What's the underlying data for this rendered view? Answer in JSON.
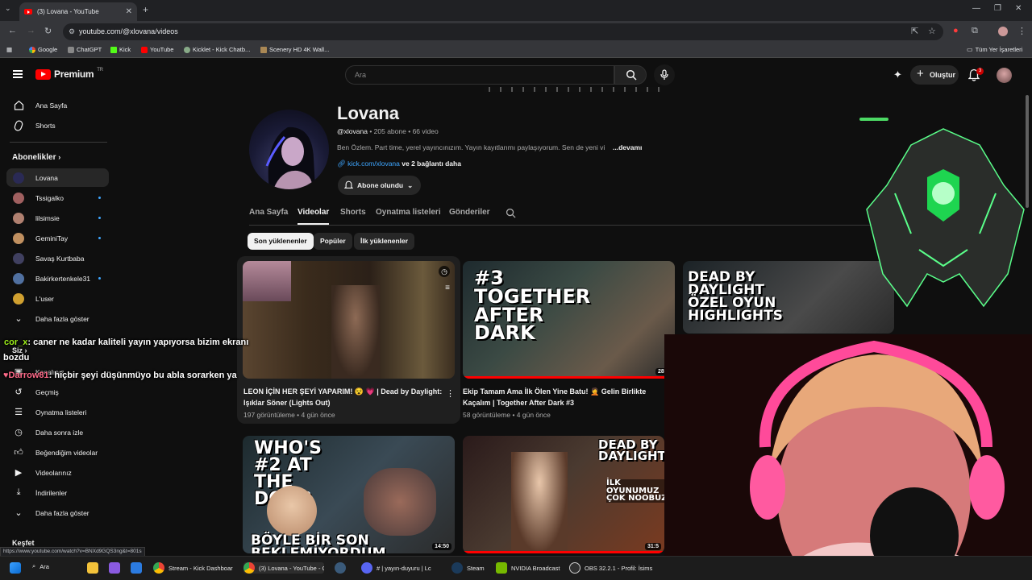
{
  "browser": {
    "tab_title": "(3) Lovana - YouTube",
    "url": "youtube.com/@xlovana/videos",
    "bookmarks": [
      "Google",
      "ChatGPT",
      "Kick",
      "YouTube",
      "Kicklet - Kick Chatb...",
      "Scenery HD 4K Wall..."
    ],
    "all_bookmarks": "Tüm Yer İşaretleri"
  },
  "masthead": {
    "logo_text": "Premium",
    "logo_region": "TR",
    "search_placeholder": "Ara",
    "create_label": "Oluştur",
    "notification_count": "3"
  },
  "sidebar": {
    "home": "Ana Sayfa",
    "shorts": "Shorts",
    "subscriptions_heading": "Abonelikler",
    "subscriptions": [
      {
        "name": "Lovana",
        "live": false,
        "color": "#2a2a55"
      },
      {
        "name": "Tssigalko",
        "live": true,
        "color": "#a06060"
      },
      {
        "name": "lilsimsie",
        "live": true,
        "color": "#b08070"
      },
      {
        "name": "GeminiTay",
        "live": true,
        "color": "#c09060"
      },
      {
        "name": "Savaş Kurtbaba",
        "live": false,
        "color": "#404060"
      },
      {
        "name": "Bakirkertenkele31",
        "live": true,
        "color": "#5070a0"
      },
      {
        "name": "L'user",
        "live": false,
        "color": "#d0a030"
      }
    ],
    "show_more": "Daha fazla göster",
    "you_heading": "Siz",
    "channel": "Kanalınız",
    "history": "Geçmiş",
    "playlists": "Oynatma listeleri",
    "watch_later": "Daha sonra izle",
    "liked": "Beğendiğim videolar",
    "your_videos": "Videolarınız",
    "downloads": "İndirilenler",
    "show_more_2": "Daha fazla göster",
    "explore": "Keşfet"
  },
  "channel": {
    "name": "Lovana",
    "handle": "@xlovana",
    "subscribers": "205 abone",
    "video_count": "66 video",
    "description": "Ben Özlem. Part time, yerel yayıncınızım. Yayın kayıtlarımı paylaşıyorum. Sen de yeni vi",
    "more": "...devamı",
    "link": "kick.com/xlovana",
    "link_more": "ve 2 bağlantı daha",
    "subscribe_label": "Abone olundu",
    "tabs": [
      "Ana Sayfa",
      "Videolar",
      "Shorts",
      "Oynatma listeleri",
      "Gönderiler"
    ],
    "active_tab": "Videolar",
    "chips": [
      "Son yüklenenler",
      "Popüler",
      "İlk yüklenenler"
    ]
  },
  "videos": [
    {
      "title": "LEON İÇİN HER ŞEYİ YAPARIM! 😵 💗 | Dead by Daylight: Işıklar Söner (Lights Out)",
      "views": "197 görüntüleme",
      "age": "4 gün önce",
      "duration": ""
    },
    {
      "title": "Ekip Tamam Ama İlk Ölen Yine Batu! 🤦 Gelin Birlikte Kaçalım | Together After Dark #3",
      "views": "58 görüntüleme",
      "age": "4 gün önce",
      "duration": "28:2",
      "thumb_text": "#3 TOGETHER AFTER DARK"
    },
    {
      "title": "",
      "views": "",
      "age": "",
      "duration": "",
      "thumb_text": "DEAD BY DAYLIGHT ÖZEL OYUN HIGHLIGHTS"
    },
    {
      "title": "",
      "views": "",
      "age": "",
      "duration": "14:50",
      "thumb_text_top": "WHO'S #2 AT THE DOOR",
      "thumb_text_bottom": "BÖYLE BİR SON BEKLEMİYORDUM"
    },
    {
      "title": "",
      "views": "",
      "age": "",
      "duration": "31:5",
      "thumb_text": "DEAD BY DAYLIGHT",
      "thumb_text_2": "İLK OYUNUMUZ ÇOK NOOBUZ"
    }
  ],
  "chat": [
    {
      "user": "cor_x",
      "message": ": caner ne kadar kaliteli yayın yapıyorsa bizim ekranı",
      "wrap": "bozdu"
    },
    {
      "user": "Darrow81",
      "message": ": hiçbir şeyi düşünmüyo bu abla sorarken ya"
    }
  ],
  "status_url": "https://www.youtube.com/watch?v=BNXd9GQS3ng&t=801s",
  "taskbar": {
    "search": "Ara",
    "items": [
      "Stream - Kick Dashboar",
      "(3) Lovana - YouTube - G",
      "# | yayın-duyuru | Lc",
      "Steam",
      "NVIDIA Broadcast",
      "OBS 32.2.1 - Profil: İsims"
    ]
  },
  "colors": {
    "accent_red": "#ff0000",
    "link_blue": "#3ea6ff",
    "chat_user": "#9ef01a"
  }
}
